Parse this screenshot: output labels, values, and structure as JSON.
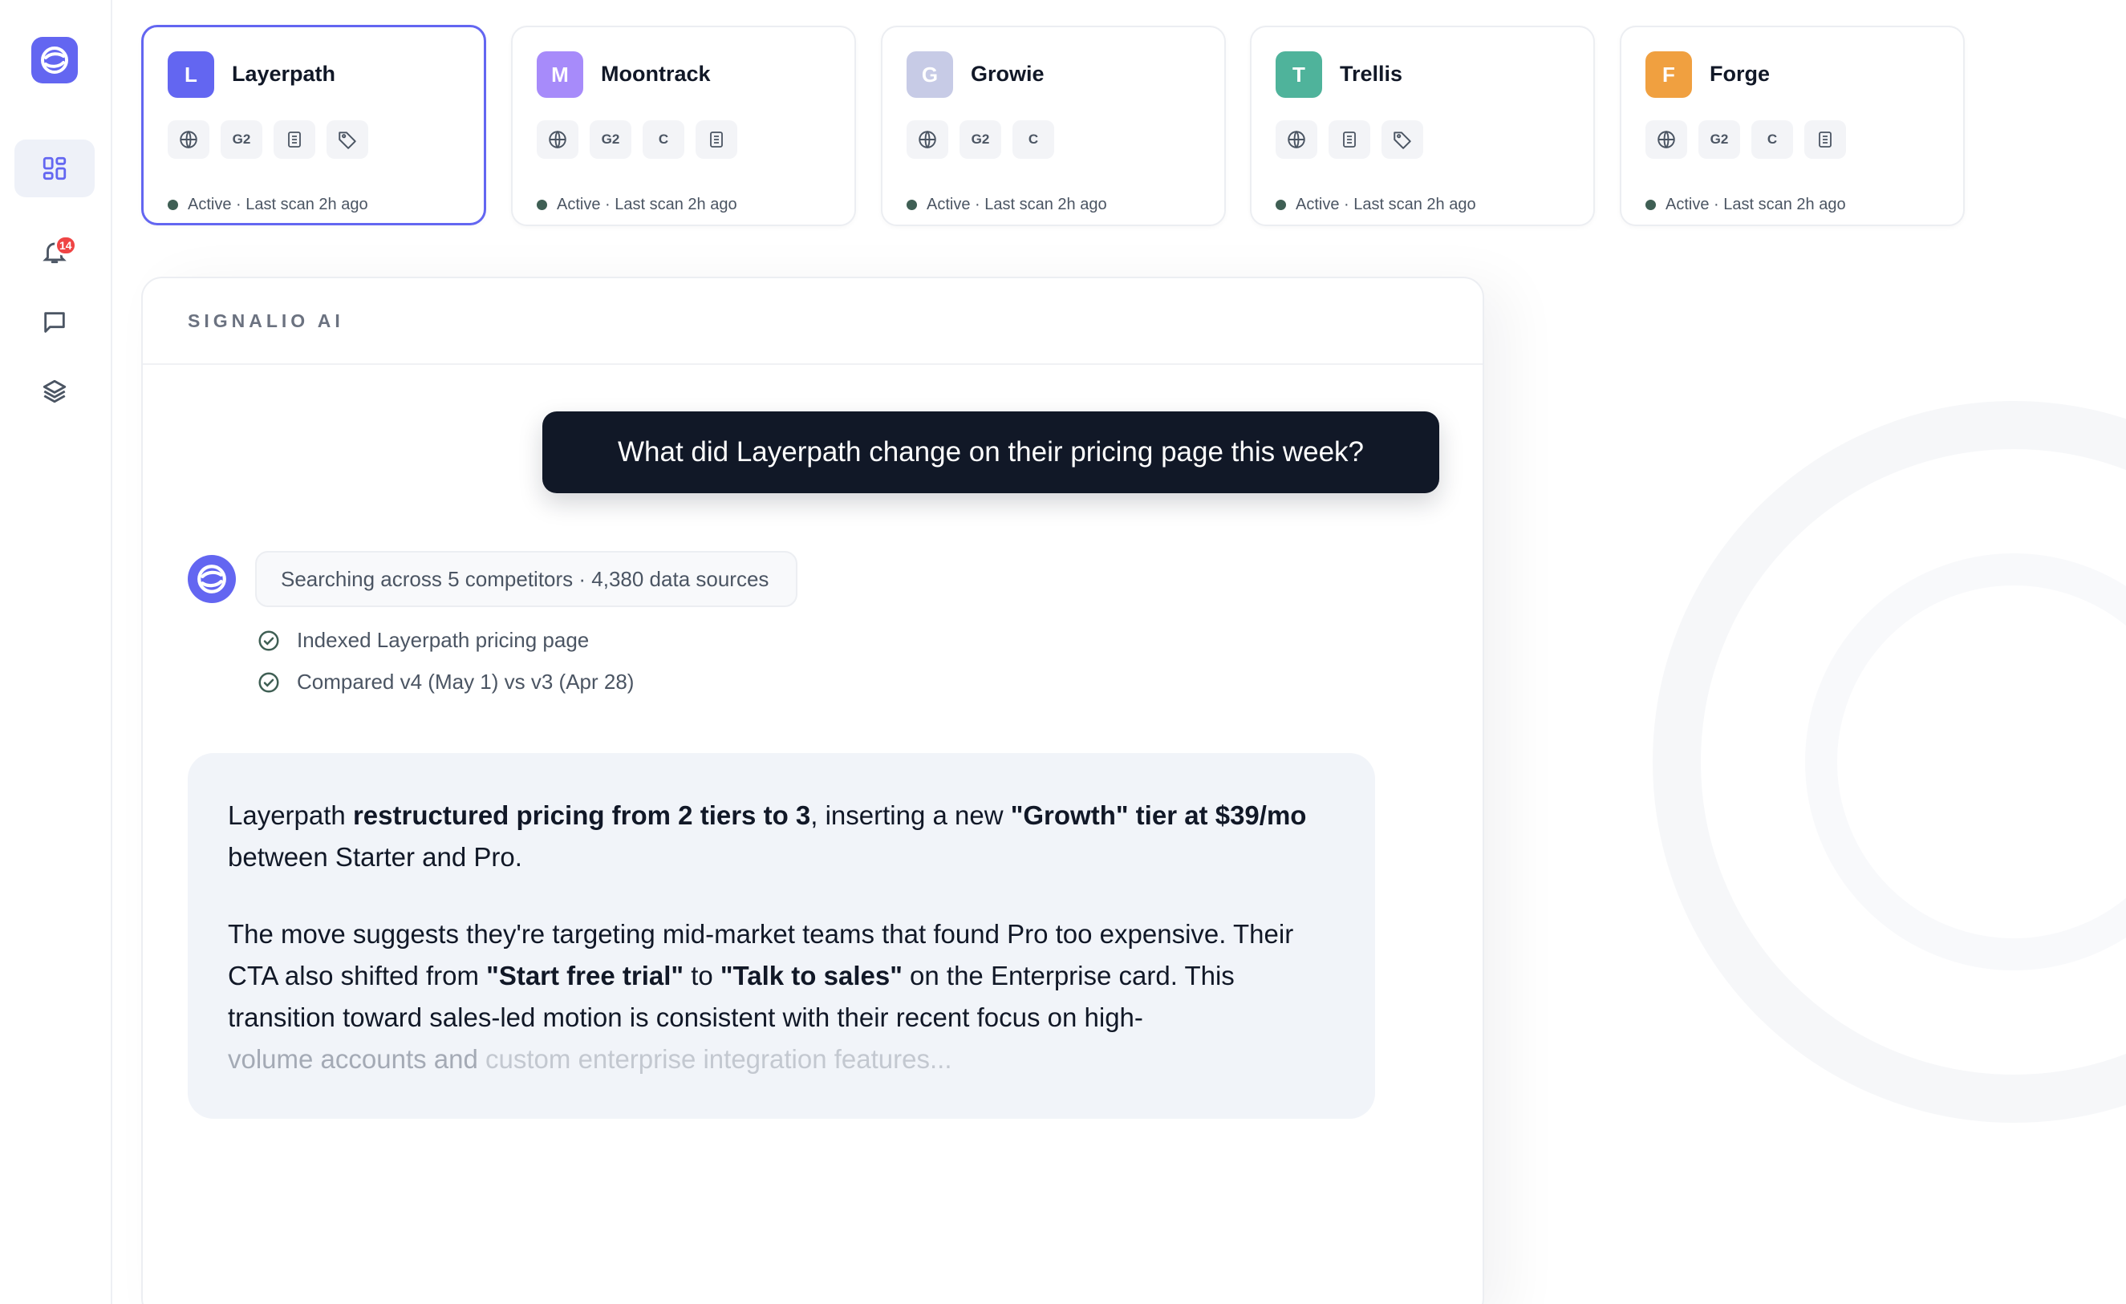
{
  "sidebar": {
    "logo_icon": "signalio-logo-icon",
    "items": [
      {
        "icon": "dashboard-icon",
        "active": true
      },
      {
        "icon": "bell-icon",
        "badge": "14"
      },
      {
        "icon": "chat-icon"
      },
      {
        "icon": "layers-icon"
      }
    ]
  },
  "competitors": [
    {
      "initial": "L",
      "name": "Layerpath",
      "color": "#6366f1",
      "chips": [
        "globe",
        "G2",
        "doc",
        "tag"
      ],
      "status": "Active · Last scan 2h ago",
      "selected": true
    },
    {
      "initial": "M",
      "name": "Moontrack",
      "color": "#a78bfa",
      "chips": [
        "globe",
        "G2",
        "C",
        "doc"
      ],
      "status": "Active · Last scan 2h ago"
    },
    {
      "initial": "G",
      "name": "Growie",
      "color": "#c7cbe6",
      "chips": [
        "globe",
        "G2",
        "C"
      ],
      "status": "Active · Last scan 2h ago"
    },
    {
      "initial": "T",
      "name": "Trellis",
      "color": "#4fb39b",
      "chips": [
        "globe",
        "doc",
        "tag"
      ],
      "status": "Active · Last scan 2h ago"
    },
    {
      "initial": "F",
      "name": "Forge",
      "color": "#f0a040",
      "chips": [
        "globe",
        "G2",
        "C",
        "doc"
      ],
      "status": "Active · Last scan 2h ago"
    }
  ],
  "chat": {
    "title": "SIGNALIO AI",
    "user_message": "What did Layerpath change on their pricing page this week?",
    "search_status": "Searching across 5 competitors · 4,380 data sources",
    "steps": [
      "Indexed Layerpath pricing page",
      "Compared v4 (May 1) vs v3 (Apr 28)"
    ],
    "answer": {
      "p1": {
        "t1": "Layerpath ",
        "b1": "restructured pricing from 2 tiers to 3",
        "t2": ", inserting a new ",
        "b2": "\"Growth\" tier at $39/mo",
        "t3": " between Starter and Pro."
      },
      "p2": {
        "t1": "The move suggests they're targeting mid-market teams that found Pro too expensive. Their CTA also shifted from ",
        "b1": "\"Start free trial\"",
        "t2": " to ",
        "b2": "\"Talk to sales\"",
        "t3": " on the Enterprise card. This transition toward sales-led motion is consistent with their recent focus on high-",
        "t4a": "volume accounts and ",
        "t4b": "custom enterprise integration features..."
      }
    }
  },
  "colors": {
    "accent": "#6366f1",
    "dark": "#111827",
    "status_dot": "#3f5f54",
    "badge": "#ef4444"
  }
}
